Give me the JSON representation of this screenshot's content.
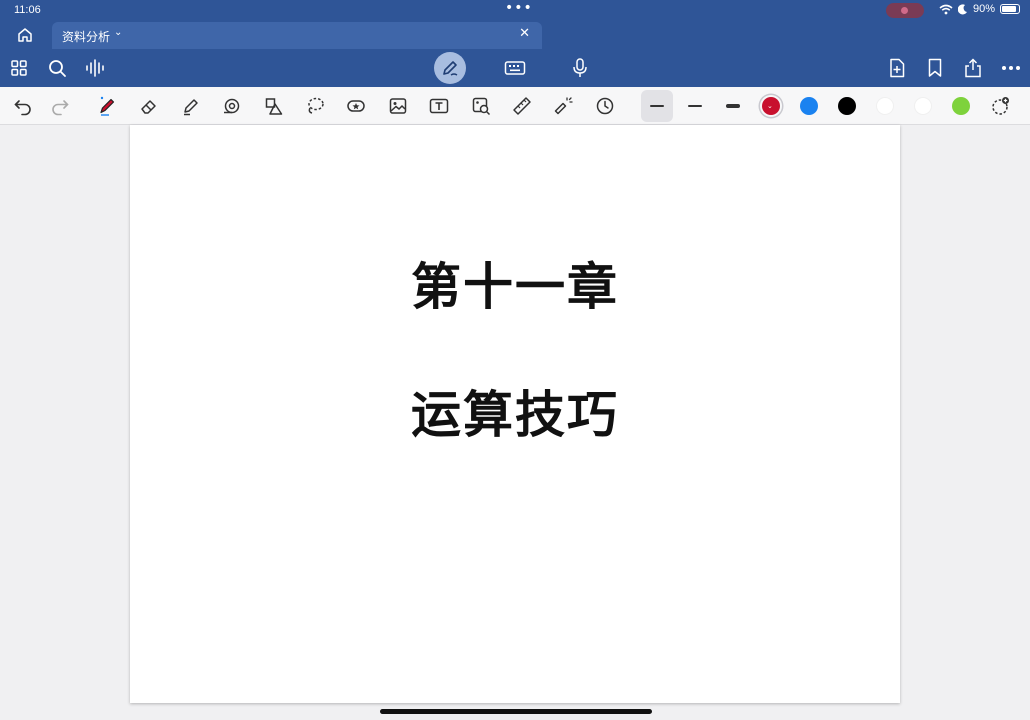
{
  "status": {
    "time": "11:06",
    "battery": "90%",
    "battery_level": 0.9
  },
  "tab": {
    "title": "资料分析"
  },
  "page": {
    "heading": "第十一章",
    "subheading": "运算技巧"
  },
  "colors": {
    "chrome": "#2f5597",
    "tab": "#3f66a9",
    "swatches": [
      "#c8102e",
      "#1a82f0",
      "#000000",
      "#ffffff",
      "#ffffff",
      "#7ed23c"
    ]
  },
  "icons": {
    "appbar": [
      "grid-icon",
      "search-icon",
      "waveform-icon",
      "pen-mode-icon",
      "keyboard-icon",
      "microphone-icon",
      "add-page-icon",
      "bookmark-icon",
      "share-icon",
      "more-icon"
    ],
    "tools": [
      "undo-icon",
      "redo-icon",
      "pen-icon",
      "eraser-icon",
      "highlighter-icon",
      "tape-icon",
      "shapes-icon",
      "lasso-icon",
      "sticker-icon",
      "image-icon",
      "text-icon",
      "scan-icon",
      "ruler-icon",
      "laser-icon",
      "clock-icon",
      "add-color-icon"
    ]
  }
}
